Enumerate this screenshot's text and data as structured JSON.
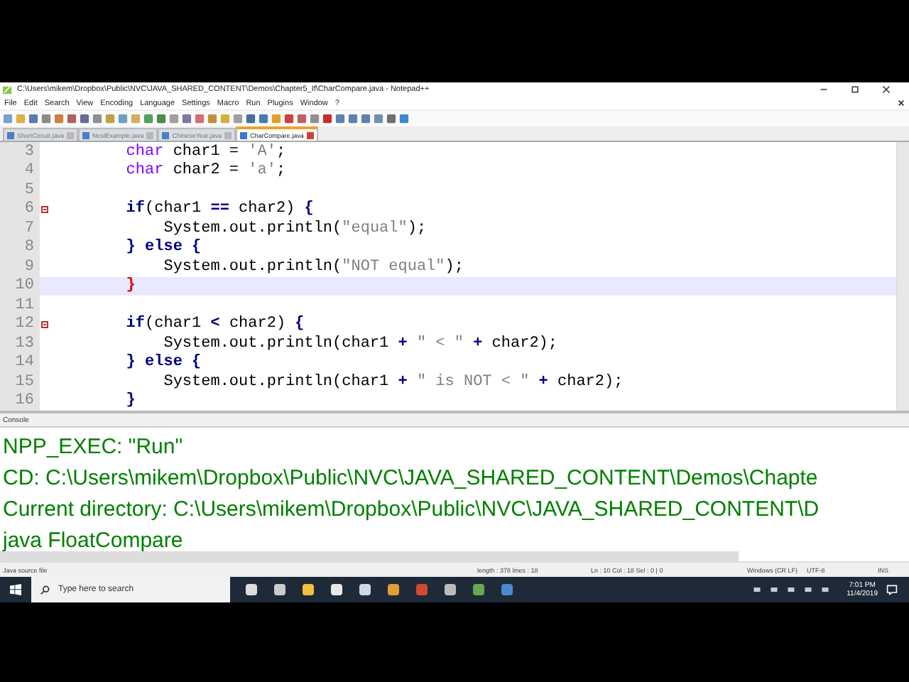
{
  "window": {
    "title": "C:\\Users\\mikem\\Dropbox\\Public\\NVC\\JAVA_SHARED_CONTENT\\Demos\\Chapter5_If\\CharCompare.java - Notepad++"
  },
  "menu": [
    "File",
    "Edit",
    "Search",
    "View",
    "Encoding",
    "Language",
    "Settings",
    "Macro",
    "Run",
    "Plugins",
    "Window",
    "?"
  ],
  "tabs": [
    {
      "label": "ShortCircuit.java",
      "selected": false
    },
    {
      "label": "NestExample.java",
      "selected": false
    },
    {
      "label": "ChineseYear.java",
      "selected": false
    },
    {
      "label": "CharCompare.java",
      "selected": true
    }
  ],
  "editor": {
    "lines": [
      {
        "number": "3",
        "selected": false,
        "fold": false,
        "tokens": [
          {
            "text": "        char",
            "kind": "type"
          },
          {
            "text": " char1 = ",
            "kind": "plain"
          },
          {
            "text": "'A'",
            "kind": "string"
          },
          {
            "text": ";",
            "kind": "plain"
          }
        ]
      },
      {
        "number": "4",
        "selected": false,
        "fold": false,
        "tokens": [
          {
            "text": "        char",
            "kind": "type"
          },
          {
            "text": " char2 = ",
            "kind": "plain"
          },
          {
            "text": "'a'",
            "kind": "string"
          },
          {
            "text": ";",
            "kind": "plain"
          }
        ]
      },
      {
        "number": "5",
        "selected": false,
        "fold": false
      },
      {
        "number": "6",
        "selected": false,
        "fold": true,
        "tokens": [
          {
            "text": "        if",
            "kind": "keyword"
          },
          {
            "text": "(char1 ",
            "kind": "plain"
          },
          {
            "text": "==",
            "kind": "op"
          },
          {
            "text": " char2) ",
            "kind": "plain"
          },
          {
            "text": "{",
            "kind": "op"
          }
        ]
      },
      {
        "number": "7",
        "selected": false,
        "fold": false,
        "tokens": [
          {
            "text": "            System.out.println(",
            "kind": "plain"
          },
          {
            "text": "\"equal\"",
            "kind": "string"
          },
          {
            "text": ");",
            "kind": "plain"
          }
        ]
      },
      {
        "number": "8",
        "selected": false,
        "fold": false,
        "tokens": [
          {
            "text": "        } ",
            "kind": "op"
          },
          {
            "text": "else",
            "kind": "keyword"
          },
          {
            "text": " {",
            "kind": "op"
          }
        ]
      },
      {
        "number": "9",
        "selected": false,
        "fold": false,
        "tokens": [
          {
            "text": "            System.out.println(",
            "kind": "plain"
          },
          {
            "text": "\"NOT equal\"",
            "kind": "string"
          },
          {
            "text": ");",
            "kind": "plain"
          }
        ]
      },
      {
        "number": "10",
        "selected": true,
        "fold": false,
        "tokens": [
          {
            "text": "        }",
            "kind": "match"
          }
        ]
      },
      {
        "number": "11",
        "selected": false,
        "fold": false
      },
      {
        "number": "12",
        "selected": false,
        "fold": true,
        "tokens": [
          {
            "text": "        if",
            "kind": "keyword"
          },
          {
            "text": "(char1 ",
            "kind": "plain"
          },
          {
            "text": "<",
            "kind": "op"
          },
          {
            "text": " char2) ",
            "kind": "plain"
          },
          {
            "text": "{",
            "kind": "op"
          }
        ]
      },
      {
        "number": "13",
        "selected": false,
        "fold": false,
        "tokens": [
          {
            "text": "            System.out.println(char1 ",
            "kind": "plain"
          },
          {
            "text": "+",
            "kind": "op"
          },
          {
            "text": " \" < \" ",
            "kind": "string"
          },
          {
            "text": "+",
            "kind": "op"
          },
          {
            "text": " char2);",
            "kind": "plain"
          }
        ]
      },
      {
        "number": "14",
        "selected": false,
        "fold": false,
        "tokens": [
          {
            "text": "        } ",
            "kind": "op"
          },
          {
            "text": "else",
            "kind": "keyword"
          },
          {
            "text": " {",
            "kind": "op"
          }
        ]
      },
      {
        "number": "15",
        "selected": false,
        "fold": false,
        "tokens": [
          {
            "text": "            System.out.println(char1 ",
            "kind": "plain"
          },
          {
            "text": "+",
            "kind": "op"
          },
          {
            "text": " \" is NOT < \" ",
            "kind": "string"
          },
          {
            "text": "+",
            "kind": "op"
          },
          {
            "text": " char2);",
            "kind": "plain"
          }
        ]
      },
      {
        "number": "16",
        "selected": false,
        "fold": false,
        "tokens": [
          {
            "text": "        }",
            "kind": "op"
          }
        ]
      }
    ]
  },
  "console": {
    "title": "Console",
    "lines": [
      "NPP_EXEC: \"Run\"",
      "CD: C:\\Users\\mikem\\Dropbox\\Public\\NVC\\JAVA_SHARED_CONTENT\\Demos\\Chapte",
      "Current directory: C:\\Users\\mikem\\Dropbox\\Public\\NVC\\JAVA_SHARED_CONTENT\\D",
      "java FloatCompare"
    ]
  },
  "status_bar": [
    "Java source file",
    "length : 378    lines : 18",
    "Ln : 10    Col : 18    Sel : 0 | 0",
    "Windows (CR LF)",
    "UTF-8",
    "INS"
  ],
  "taskbar": {
    "search": {
      "placeholder": "Type here to search"
    },
    "time": "7:01 PM",
    "date": "11/4/2019"
  }
}
